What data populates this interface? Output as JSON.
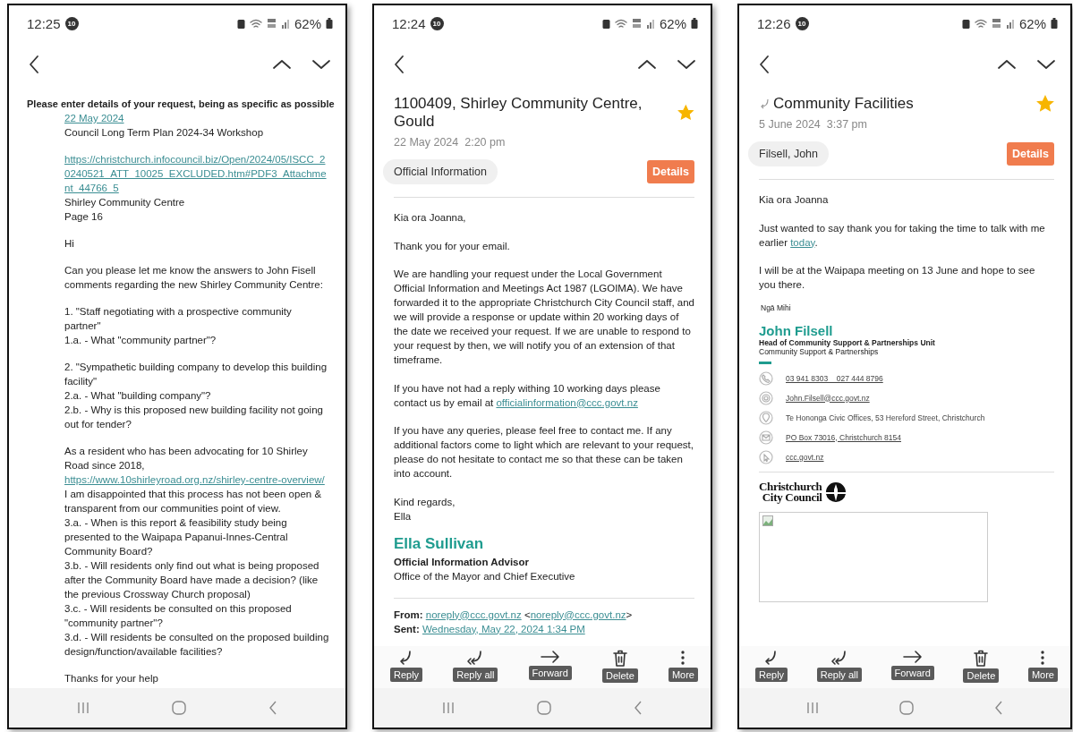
{
  "phones": [
    {
      "status_bar": {
        "time": "12:25",
        "badge": "10",
        "battery": "62%"
      },
      "body": [
        {
          "kind": "heading",
          "text": "Please enter details of your request, being as specific as possible"
        },
        {
          "kind": "quoted",
          "lines": [
            [
              {
                "kind": "link",
                "text": "22 May 2024"
              }
            ],
            [
              {
                "kind": "text",
                "text": "Council Long Term Plan 2024-34 Workshop"
              }
            ]
          ]
        },
        {
          "kind": "quoted",
          "lines": [
            [
              {
                "kind": "link",
                "text": "https://christchurch.infocouncil.biz/Open/2024/05/ISCC_20240521_ATT_10025_EXCLUDED.htm#PDF3_Attachment_44766_5"
              }
            ],
            [
              {
                "kind": "text",
                "text": "Shirley Community Centre"
              }
            ],
            [
              {
                "kind": "text",
                "text": "Page 16"
              }
            ]
          ]
        },
        {
          "kind": "quoted",
          "lines": [
            [
              {
                "kind": "text",
                "text": "Hi"
              }
            ]
          ]
        },
        {
          "kind": "quoted",
          "lines": [
            [
              {
                "kind": "text",
                "text": "Can you please let me know the answers to John Fisell comments regarding the new Shirley Community Centre:"
              }
            ]
          ]
        },
        {
          "kind": "quoted",
          "lines": [
            [
              {
                "kind": "text",
                "text": "1. \"Staff negotiating with a prospective community partner\""
              }
            ],
            [
              {
                "kind": "text",
                "text": "1.a. - What \"community partner\"?"
              }
            ]
          ]
        },
        {
          "kind": "quoted",
          "lines": [
            [
              {
                "kind": "text",
                "text": "2. \"Sympathetic building company to develop this building facility\""
              }
            ],
            [
              {
                "kind": "text",
                "text": "2.a. - What \"building company\"?"
              }
            ],
            [
              {
                "kind": "text",
                "text": "2.b. - Why is this proposed new building facility not going out for tender?"
              }
            ]
          ]
        },
        {
          "kind": "quoted",
          "lines": [
            [
              {
                "kind": "text",
                "text": "As a resident who has been advocating for 10 Shirley Road since 2018,"
              }
            ],
            [
              {
                "kind": "link",
                "text": "https://www.10shirleyroad.org.nz/shirley-centre-overview/"
              }
            ],
            [
              {
                "kind": "text",
                "text": "I am disappointed that this process has not been open & transparent from our communities point of view."
              }
            ],
            [
              {
                "kind": "text",
                "text": "3.a. - When is this report & feasibility study being presented to the Waipapa Papanui-Innes-Central Community Board?"
              }
            ],
            [
              {
                "kind": "text",
                "text": "3.b. - Will residents only find out what is being proposed after the Community Board have made a decision? (like the previous Crossway Church proposal)"
              }
            ],
            [
              {
                "kind": "text",
                "text": "3.c. - Will residents be consulted on this proposed \"community partner\"?"
              }
            ],
            [
              {
                "kind": "text",
                "text": "3.d. - Will residents be consulted on the proposed building design/function/available facilities?"
              }
            ]
          ]
        },
        {
          "kind": "quoted",
          "lines": [
            [
              {
                "kind": "text",
                "text": "Thanks for your help"
              }
            ]
          ]
        }
      ]
    },
    {
      "status_bar": {
        "time": "12:24",
        "badge": "10",
        "battery": "62%"
      },
      "message": {
        "subject": "1100409, Shirley Community Centre, Gould",
        "replied": false,
        "starred": true,
        "date": "22 May 2024  2:20 pm",
        "sender": "Official Information",
        "details": "Details"
      },
      "body": [
        {
          "kind": "paragraph",
          "lines": [
            [
              {
                "kind": "text",
                "text": "Kia ora Joanna,"
              }
            ]
          ]
        },
        {
          "kind": "paragraph",
          "lines": [
            [
              {
                "kind": "text",
                "text": "Thank you for your email."
              }
            ]
          ]
        },
        {
          "kind": "paragraph",
          "lines": [
            [
              {
                "kind": "text",
                "text": "We are handling your request under the Local Government Official Information and Meetings Act 1987 (LGOIMA). We have forwarded it to the appropriate Christchurch City Council staff, and we will provide a response or update within 20 working days of the date we received your request. If we are unable to respond to your request by then, we will notify you of an extension of that timeframe."
              }
            ]
          ]
        },
        {
          "kind": "paragraph",
          "lines": [
            [
              {
                "kind": "text",
                "text": "If you have not had a reply withing 10 working days please contact us by email at "
              },
              {
                "kind": "link",
                "text": "officialinformation@ccc.govt.nz"
              }
            ]
          ]
        },
        {
          "kind": "paragraph",
          "lines": [
            [
              {
                "kind": "text",
                "text": "If you have any queries, please feel free to contact me. If any additional factors come to light which are relevant to your request, please do not hesitate to contact me so that these can be taken into account."
              }
            ]
          ]
        },
        {
          "kind": "paragraph",
          "lines": [
            [
              {
                "kind": "text",
                "text": "Kind regards,"
              }
            ],
            [
              {
                "kind": "text",
                "text": "Ella"
              }
            ]
          ]
        },
        {
          "kind": "signature",
          "name": "Ella Sullivan",
          "title": "Official Information Advisor",
          "department": "Office of the Mayor and Chief Executive"
        },
        {
          "kind": "divider"
        },
        {
          "kind": "header_lines",
          "lines": [
            [
              {
                "kind": "bold",
                "text": "From: "
              },
              {
                "kind": "link",
                "text": "noreply@ccc.govt.nz"
              },
              {
                "kind": "text",
                "text": " <"
              },
              {
                "kind": "link",
                "text": "noreply@ccc.govt.nz"
              },
              {
                "kind": "text",
                "text": ">"
              }
            ],
            [
              {
                "kind": "bold",
                "text": "Sent: "
              },
              {
                "kind": "link",
                "text": "Wednesday, May 22, 2024 1:34 PM"
              }
            ]
          ]
        }
      ],
      "actions": [
        {
          "kind": "reply",
          "label": "Reply"
        },
        {
          "kind": "reply_all",
          "label": "Reply all"
        },
        {
          "kind": "forward",
          "label": "Forward"
        },
        {
          "kind": "delete",
          "label": "Delete"
        },
        {
          "kind": "more",
          "label": "More"
        }
      ]
    },
    {
      "status_bar": {
        "time": "12:26",
        "badge": "10",
        "battery": "62%"
      },
      "message": {
        "subject": "Community Facilities",
        "replied": true,
        "starred": true,
        "date": "5 June 2024  3:37 pm",
        "sender": "Filsell, John",
        "details": "Details"
      },
      "body": [
        {
          "kind": "paragraph",
          "lines": [
            [
              {
                "kind": "text",
                "text": "Kia ora Joanna"
              }
            ]
          ]
        },
        {
          "kind": "paragraph",
          "lines": [
            [
              {
                "kind": "text",
                "text": "Just wanted to say thank you for taking the time to talk with me earlier "
              },
              {
                "kind": "link",
                "text": "today"
              },
              {
                "kind": "text",
                "text": "."
              }
            ]
          ]
        },
        {
          "kind": "paragraph",
          "lines": [
            [
              {
                "kind": "text",
                "text": "I will be at the Waipapa meeting on 13 June and hope to see you there."
              }
            ]
          ]
        },
        {
          "kind": "small",
          "text": "Ngā Mihi"
        },
        {
          "kind": "signature_compact",
          "name": "John Filsell",
          "title": "Head of Community Support & Partnerships Unit",
          "department": "Community Support & Partnerships"
        },
        {
          "kind": "contacts",
          "items": [
            {
              "kind": "phone",
              "link": true,
              "text": "03 941 8303    027 444 8796"
            },
            {
              "kind": "email",
              "link": true,
              "text": "John.Filsell@ccc.govt.nz"
            },
            {
              "kind": "location",
              "link": false,
              "text": "Te Hononga Civic Offices, 53 Hereford Street, Christchurch"
            },
            {
              "kind": "mail",
              "link": true,
              "text": "PO Box 73016, Christchurch 8154"
            },
            {
              "kind": "web",
              "link": true,
              "text": "ccc.govt.nz"
            }
          ]
        },
        {
          "kind": "divider"
        },
        {
          "kind": "logo",
          "lines": [
            "Christchurch",
            "City Council"
          ]
        },
        {
          "kind": "image_placeholder"
        }
      ],
      "actions": [
        {
          "kind": "reply",
          "label": "Reply"
        },
        {
          "kind": "reply_all",
          "label": "Reply all"
        },
        {
          "kind": "forward",
          "label": "Forward"
        },
        {
          "kind": "delete",
          "label": "Delete"
        },
        {
          "kind": "more",
          "label": "More"
        }
      ]
    }
  ]
}
